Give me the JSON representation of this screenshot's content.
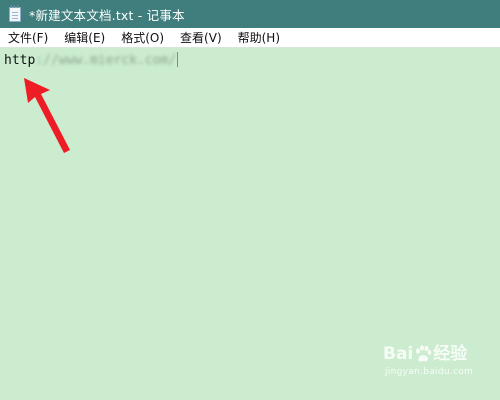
{
  "window": {
    "title": "*新建文本文档.txt - 记事本",
    "icon": "notepad-icon"
  },
  "menu": {
    "items": [
      {
        "id": "file",
        "label": "文件(F)"
      },
      {
        "id": "edit",
        "label": "编辑(E)"
      },
      {
        "id": "format",
        "label": "格式(O)"
      },
      {
        "id": "view",
        "label": "查看(V)"
      },
      {
        "id": "help",
        "label": "帮助(H)"
      }
    ]
  },
  "editor": {
    "typed_text": "http",
    "blurred_text": "://www.mierck.com/"
  },
  "watermark": {
    "brand_left": "Bai",
    "brand_right": "经验",
    "url": "jingyan.baidu.com"
  },
  "colors": {
    "titlebar": "#3f7e7d",
    "menubar": "#ffffff",
    "editor_background": "#cbeccf",
    "annotation_arrow": "#ee1c24"
  }
}
